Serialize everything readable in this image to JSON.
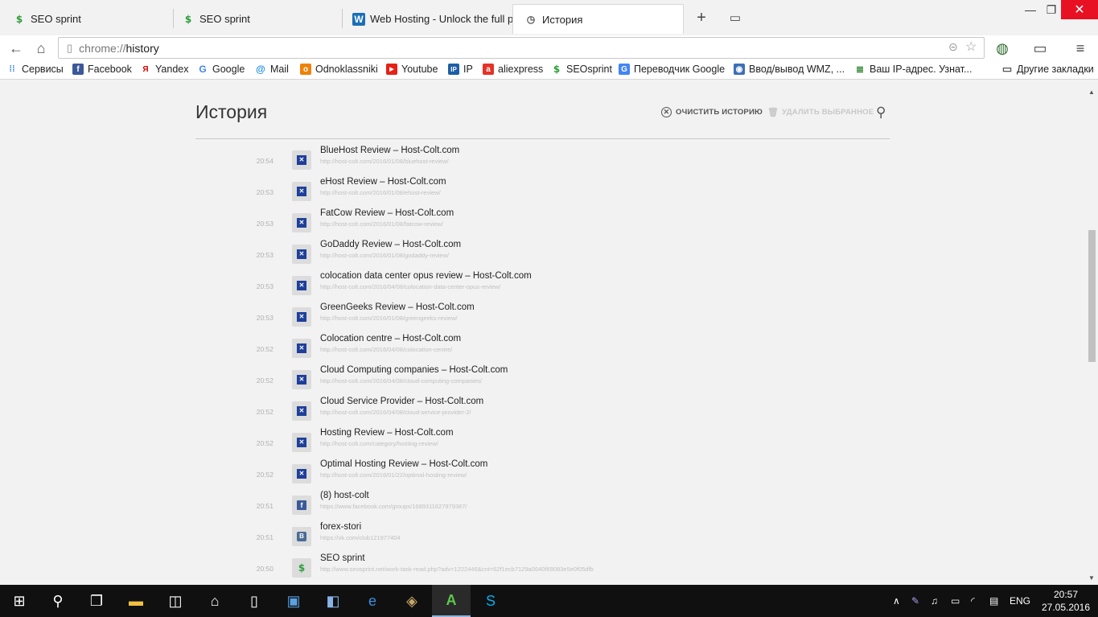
{
  "tabs": [
    {
      "title": "SEO sprint",
      "favicon": "seosprint-icon"
    },
    {
      "title": "SEO sprint",
      "favicon": "seosprint-icon"
    },
    {
      "title": "Web Hosting - Unlock the full p",
      "title_fade": "o",
      "favicon": "webhosting-icon"
    },
    {
      "title": "История",
      "favicon": "history-icon",
      "active": true
    }
  ],
  "toolbar": {
    "url_scheme": "chrome://",
    "url_host": "history"
  },
  "bookmarks": [
    {
      "label": "Сервисы",
      "icon": "apps-icon"
    },
    {
      "label": "Facebook",
      "icon": "facebook-icon"
    },
    {
      "label": "Yandex",
      "icon": "yandex-icon"
    },
    {
      "label": "Google",
      "icon": "google-icon"
    },
    {
      "label": "Mail",
      "icon": "mail-icon"
    },
    {
      "label": "Odnoklassniki",
      "icon": "odnoklassniki-icon"
    },
    {
      "label": "Youtube",
      "icon": "youtube-icon"
    },
    {
      "label": "IP",
      "icon": "ip-icon"
    },
    {
      "label": "aliexpress",
      "icon": "aliexpress-icon"
    },
    {
      "label": "SEOsprint",
      "icon": "seosprint-icon"
    },
    {
      "label": "Переводчик Google",
      "icon": "translate-icon"
    },
    {
      "label": "Ввод/вывод WMZ, ...",
      "icon": "wmz-icon"
    },
    {
      "label": "Ваш IP-адрес. Узнат...",
      "icon": "ipaddr-icon"
    },
    {
      "label": "Другие закладки",
      "icon": "folder-icon"
    }
  ],
  "history": {
    "title": "История",
    "clear_label": "очистить историю",
    "delete_label": "удалить выбранное",
    "items": [
      {
        "time": "20:54",
        "title": "BlueHost Review – Host-Colt.com",
        "url": "http://host-colt.com/2016/01/08/bluehost-review/",
        "favicon": "hostcolt-icon"
      },
      {
        "time": "20:53",
        "title": "eHost Review – Host-Colt.com",
        "url": "http://host-colt.com/2016/01/08/ehost-review/",
        "favicon": "hostcolt-icon"
      },
      {
        "time": "20:53",
        "title": "FatCow Review – Host-Colt.com",
        "url": "http://host-colt.com/2016/01/08/fatcow-review/",
        "favicon": "hostcolt-icon"
      },
      {
        "time": "20:53",
        "title": "GoDaddy Review – Host-Colt.com",
        "url": "http://host-colt.com/2016/01/08/godaddy-review/",
        "favicon": "hostcolt-icon"
      },
      {
        "time": "20:53",
        "title": "colocation data center opus review – Host-Colt.com",
        "url": "http://host-colt.com/2016/04/08/colocation-data-center-opus-review/",
        "favicon": "hostcolt-icon"
      },
      {
        "time": "20:53",
        "title": "GreenGeeks Review – Host-Colt.com",
        "url": "http://host-colt.com/2016/01/08/greengeeks-review/",
        "favicon": "hostcolt-icon"
      },
      {
        "time": "20:52",
        "title": "Colocation centre – Host-Colt.com",
        "url": "http://host-colt.com/2016/04/08/colocation-centre/",
        "favicon": "hostcolt-icon"
      },
      {
        "time": "20:52",
        "title": "Cloud Computing companies – Host-Colt.com",
        "url": "http://host-colt.com/2016/04/08/cloud-computing-companies/",
        "favicon": "hostcolt-icon"
      },
      {
        "time": "20:52",
        "title": "Cloud Service Provider – Host-Colt.com",
        "url": "http://host-colt.com/2016/04/08/cloud-service-provider-2/",
        "favicon": "hostcolt-icon"
      },
      {
        "time": "20:52",
        "title": "Hosting Review – Host-Colt.com",
        "url": "http://host-colt.com/category/hosting-review/",
        "favicon": "hostcolt-icon"
      },
      {
        "time": "20:52",
        "title": "Optimal Hosting Review – Host-Colt.com",
        "url": "http://host-colt.com/2016/01/22/optimal-hosting-review/",
        "favicon": "hostcolt-icon"
      },
      {
        "time": "20:51",
        "title": "(8) host-colt",
        "url": "https://www.facebook.com/groups/1689311627979387/",
        "favicon": "facebook-icon"
      },
      {
        "time": "20:51",
        "title": "forex-stori",
        "url": "https://vk.com/club121977404",
        "favicon": "vk-icon"
      },
      {
        "time": "20:50",
        "title": "SEO sprint",
        "url": "http://www.seosprint.net/work-task-read.php?adv=1222446&cnt=62f1ecb7129a0640f69083e5e0f05dfb",
        "favicon": "seosprint-icon"
      }
    ]
  },
  "taskbar": {
    "language": "ENG",
    "time": "20:57",
    "date": "27.05.2016"
  }
}
